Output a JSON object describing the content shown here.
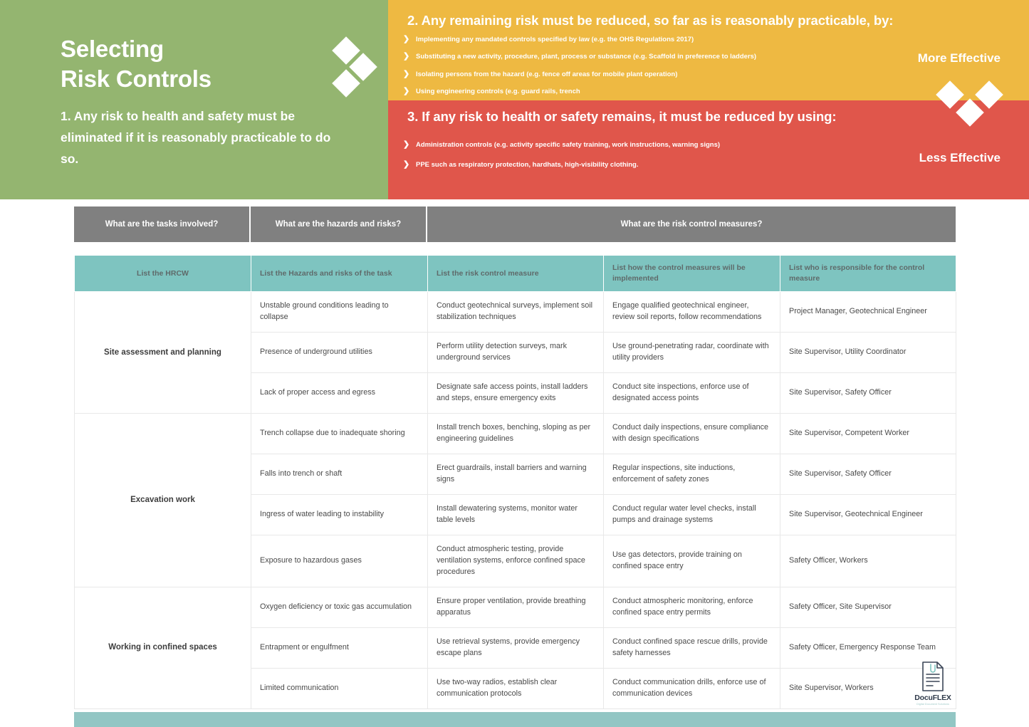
{
  "banner": {
    "title_line1": "Selecting",
    "title_line2": "Risk Controls",
    "subtitle": "1. Any risk to health and safety must be eliminated if it is reasonably practicable to do so.",
    "section2": {
      "heading": "2. Any remaining risk must be reduced, so far as is reasonably practicable, by:",
      "bullets": [
        "Implementing any mandated controls specified by law (e.g. the OHS Regulations 2017)",
        "Substituting a new activity, procedure, plant, process or substance (e.g. Scaffold in preference to ladders)",
        "Isolating persons from the hazard (e.g. fence off areas for mobile plant operation)",
        "Using engineering controls (e.g. guard rails, trench"
      ],
      "effectiveness_label": "More Effective"
    },
    "section3": {
      "heading": "3. If any risk to health or safety remains, it must be reduced by using:",
      "bullets": [
        "Administration controls (e.g. activity specific safety training, work instructions, warning signs)",
        "PPE such as respiratory protection, hardhats, high-visibility clothing."
      ],
      "effectiveness_label": "Less Effective"
    },
    "bullet_glyph": "❯",
    "colors": {
      "green": "#94b570",
      "orange": "#eeb942",
      "red": "#e0564b"
    }
  },
  "table": {
    "group_headers": [
      "What are the tasks involved?",
      "What are the hazards and risks?",
      "What are the risk control measures?"
    ],
    "column_headers": [
      "List the HRCW",
      "List the Hazards and risks of the task",
      "List the risk control measure",
      "List how the control measures will be implemented",
      "List who is responsible for the control measure"
    ],
    "header_color": "#7ec4c0",
    "group_header_color": "#808080",
    "groups": [
      {
        "task": "Site assessment and planning",
        "rows": [
          {
            "hazard": "Unstable ground conditions leading to collapse",
            "control": "Conduct geotechnical surveys, implement soil stabilization techniques",
            "implementation": "Engage qualified geotechnical engineer, review soil reports, follow recommendations",
            "responsible": "Project Manager, Geotechnical Engineer"
          },
          {
            "hazard": "Presence of underground utilities",
            "control": "Perform utility detection surveys, mark underground services",
            "implementation": "Use ground-penetrating radar, coordinate with utility providers",
            "responsible": "Site Supervisor, Utility Coordinator"
          },
          {
            "hazard": "Lack of proper access and egress",
            "control": "Designate safe access points, install ladders and steps, ensure emergency exits",
            "implementation": "Conduct site inspections, enforce use of designated access points",
            "responsible": "Site Supervisor, Safety Officer"
          }
        ]
      },
      {
        "task": "Excavation work",
        "rows": [
          {
            "hazard": "Trench collapse due to inadequate shoring",
            "control": "Install trench boxes, benching, sloping as per engineering guidelines",
            "implementation": "Conduct daily inspections, ensure compliance with design specifications",
            "responsible": "Site Supervisor, Competent Worker"
          },
          {
            "hazard": "Falls into trench or shaft",
            "control": "Erect guardrails, install barriers and warning signs",
            "implementation": "Regular inspections, site inductions, enforcement of safety zones",
            "responsible": "Site Supervisor, Safety Officer"
          },
          {
            "hazard": "Ingress of water leading to instability",
            "control": "Install dewatering systems, monitor water table levels",
            "implementation": "Conduct regular water level checks, install pumps and drainage systems",
            "responsible": "Site Supervisor, Geotechnical Engineer"
          },
          {
            "hazard": "Exposure to hazardous gases",
            "control": "Conduct atmospheric testing, provide ventilation systems, enforce confined space procedures",
            "implementation": "Use gas detectors, provide training on confined space entry",
            "responsible": "Safety Officer, Workers"
          }
        ]
      },
      {
        "task": "Working in confined spaces",
        "rows": [
          {
            "hazard": "Oxygen deficiency or toxic gas accumulation",
            "control": "Ensure proper ventilation, provide breathing apparatus",
            "implementation": "Conduct atmospheric monitoring, enforce confined space entry permits",
            "responsible": "Safety Officer, Site Supervisor"
          },
          {
            "hazard": "Entrapment or engulfment",
            "control": "Use retrieval systems, provide emergency escape plans",
            "implementation": "Conduct confined space rescue drills, provide safety harnesses",
            "responsible": "Safety Officer, Emergency Response Team"
          },
          {
            "hazard": "Limited communication",
            "control": "Use two-way radios, establish clear communication protocols",
            "implementation": "Conduct communication drills, enforce use of communication devices",
            "responsible": "Site Supervisor, Workers"
          }
        ]
      }
    ]
  },
  "logo": {
    "brand": "DocuFLEX",
    "tagline": "Digital Document Solutions"
  }
}
